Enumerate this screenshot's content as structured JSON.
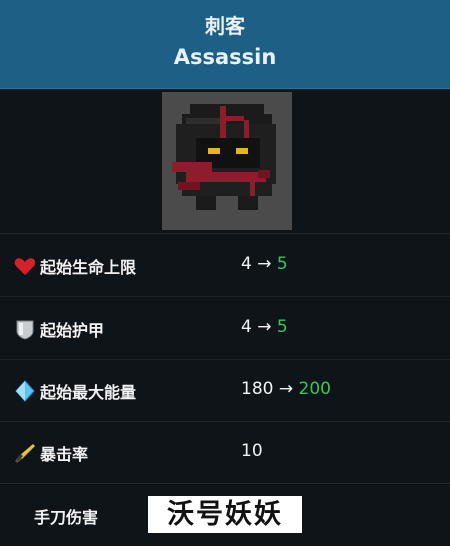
{
  "header": {
    "title_zh": "刺客",
    "title_en": "Assassin"
  },
  "portrait": {
    "icon": "assassin-character-sprite"
  },
  "stats": [
    {
      "label": "起始生命上限",
      "icon": "heart-icon",
      "base": "4",
      "arrow": "→",
      "upgraded": "5"
    },
    {
      "label": "起始护甲",
      "icon": "shield-icon",
      "base": "4",
      "arrow": "→",
      "upgraded": "5"
    },
    {
      "label": "起始最大能量",
      "icon": "energy-crystal-icon",
      "base": "180",
      "arrow": "→",
      "upgraded": "200"
    },
    {
      "label": "暴击率",
      "icon": "crit-sword-icon",
      "base": "10",
      "arrow": "",
      "upgraded": ""
    },
    {
      "label": "手刀伤害",
      "icon": "",
      "base": "",
      "arrow": "",
      "upgraded": ""
    }
  ],
  "watermark": "沃号妖妖",
  "colors": {
    "header_bg": "#1e5f86",
    "page_bg": "#0f1419",
    "upgrade_green": "#39c65a"
  }
}
